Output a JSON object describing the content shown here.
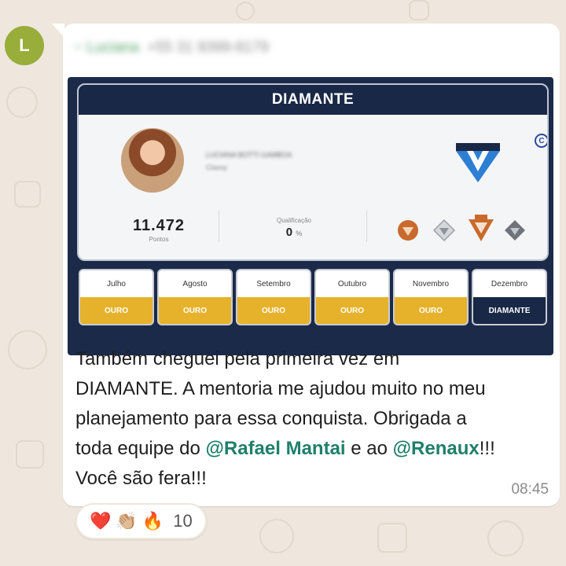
{
  "chat": {
    "avatar_initial": "L",
    "avatar_color": "#98ad3a",
    "sender_name": "~ Luciana",
    "sender_phone": "+55 31 9399-8179",
    "message_lines": [
      "Também cheguei pela primeira vez em",
      "DIAMANTE. A mentoria me ajudou muito no meu",
      "planejamento para essa conquista. Obrigada a"
    ],
    "last_line": {
      "prefix": "toda equipe do ",
      "mention1": "@Rafael Mantai",
      "middle": " e ao ",
      "mention2": "@Renaux",
      "suffix": "!!!"
    },
    "closing_line": "Você são fera!!!",
    "time": "08:45",
    "mention_color": "#1f7f6b",
    "reactions": {
      "icons": [
        "red-heart",
        "clapping-hands",
        "fire"
      ],
      "heart": "❤️",
      "clap": "👏🏼",
      "fire": "🔥",
      "count": "10"
    }
  },
  "photo": {
    "header_title": "DIAMANTE",
    "user_name_blurred": "LUCIANA BOTTI GAMBOA",
    "user_sub_blurred": "Classy",
    "points_value": "11.472",
    "points_label": "Pontos",
    "qualification_label": "Qualificação",
    "qualification_value": "0",
    "qualification_unit": "%",
    "level_badges": [
      "bronze-badge",
      "silver-diamond-badge",
      "p2v-diamond-badge",
      "gray-diamond-badge"
    ],
    "months": [
      {
        "name": "Julho",
        "level": "OURO"
      },
      {
        "name": "Agosto",
        "level": "OURO"
      },
      {
        "name": "Setembro",
        "level": "OURO"
      },
      {
        "name": "Outubro",
        "level": "OURO"
      },
      {
        "name": "Novembro",
        "level": "OURO"
      },
      {
        "name": "Dezembro",
        "level": "DIAMANTE"
      }
    ],
    "gold_color": "#e6b22b",
    "navy_color": "#1a2847"
  }
}
